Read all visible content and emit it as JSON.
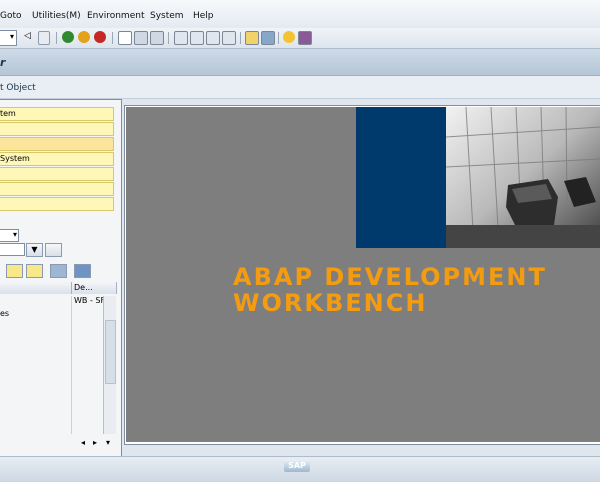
{
  "menu": {
    "items": [
      "Goto",
      "Utilities(M)",
      "Environment",
      "System",
      "Help"
    ]
  },
  "title_bar": {
    "title": "r"
  },
  "app_toolbar": {
    "link": "t Object"
  },
  "left_panel": {
    "nav_buttons": [
      {
        "label": "tem"
      },
      {
        "label": ""
      },
      {
        "label": ""
      },
      {
        "label": " System"
      },
      {
        "label": ""
      },
      {
        "label": ""
      },
      {
        "label": ""
      }
    ],
    "tree": {
      "col2_header": "De...",
      "col2_value": "WB - SF",
      "row1_col1": "es"
    }
  },
  "main": {
    "headline_1": "ABAP DEVELOPMENT",
    "headline_2": "WORKBENCH",
    "headline_color": "#f39c12",
    "blue_color": "#003a6c",
    "gray_color": "#7e7e7e"
  },
  "status": {
    "logo_text": "SAP"
  }
}
